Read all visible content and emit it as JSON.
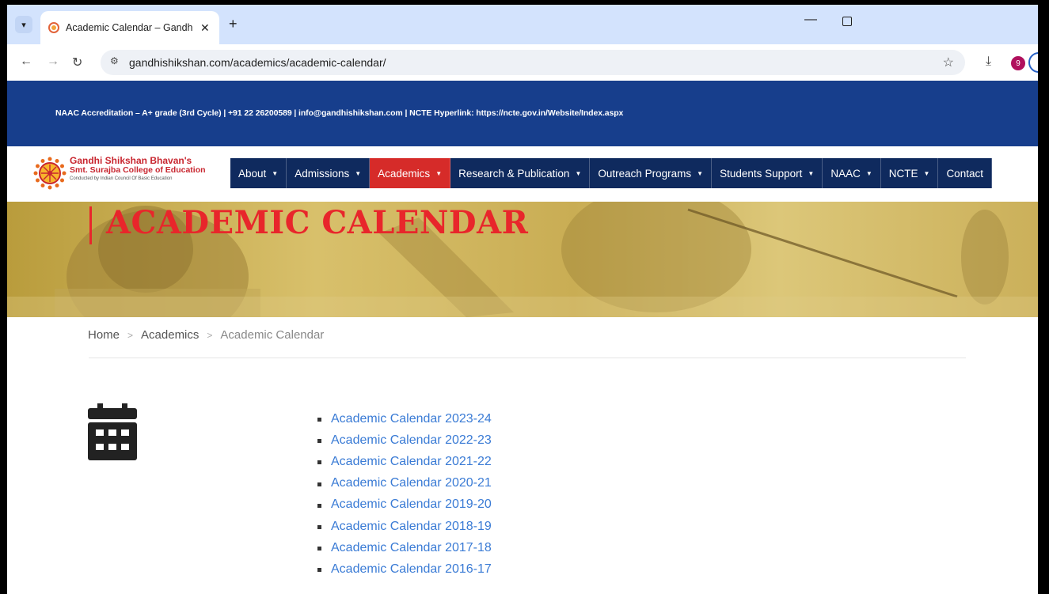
{
  "browser": {
    "tab_title": "Academic Calendar – Gandhi Sh",
    "tab_close": "✕",
    "new_tab": "+",
    "url": "gandhishikshan.com/academics/academic-calendar/",
    "profile_initial": "9"
  },
  "topbar": {
    "text": "NAAC Accreditation – A+ grade (3rd Cycle) | +91 22 26200589 | info@gandhishikshan.com | NCTE Hyperlink: https://ncte.gov.in/Website/Index.aspx"
  },
  "logo": {
    "line1": "Gandhi Shikshan Bhavan's",
    "line2": "Smt. Surajba College of Education",
    "line3": "Conducted by Indian Council Of Basic Education"
  },
  "menu": [
    {
      "label": "About",
      "caret": true,
      "active": false
    },
    {
      "label": "Admissions",
      "caret": true,
      "active": false
    },
    {
      "label": "Academics",
      "caret": true,
      "active": true
    },
    {
      "label": "Research & Publication",
      "caret": true,
      "active": false
    },
    {
      "label": "Outreach Programs",
      "caret": true,
      "active": false
    },
    {
      "label": "Students Support",
      "caret": true,
      "active": false
    },
    {
      "label": "NAAC",
      "caret": true,
      "active": false
    },
    {
      "label": "NCTE",
      "caret": true,
      "active": false
    },
    {
      "label": "Contact",
      "caret": false,
      "active": false
    }
  ],
  "banner": {
    "title": "ACADEMIC CALENDAR"
  },
  "breadcrumb": {
    "home": "Home",
    "sep": ">",
    "academics": "Academics",
    "current": "Academic Calendar"
  },
  "calendars": [
    "Academic Calendar 2023-24",
    "Academic Calendar 2022-23",
    "Academic Calendar 2021-22",
    "Academic Calendar 2020-21",
    "Academic Calendar 2019-20",
    "Academic Calendar 2018-19",
    "Academic Calendar 2017-18",
    "Academic Calendar 2016-17"
  ],
  "colors": {
    "topbar": "#173e8c",
    "menu": "#0f2a5e",
    "menu_active": "#d62b29",
    "banner_title": "#e8262b",
    "link": "#3a7bd5"
  }
}
